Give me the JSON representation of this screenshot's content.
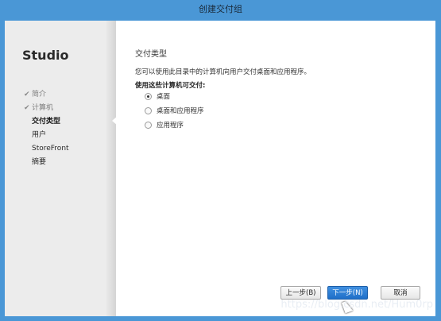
{
  "window": {
    "title": "创建交付组"
  },
  "sidebar": {
    "brand": "Studio",
    "steps": [
      {
        "label": "简介",
        "state": "done",
        "icon": "check-icon"
      },
      {
        "label": "计算机",
        "state": "done",
        "icon": "check-icon"
      },
      {
        "label": "交付类型",
        "state": "current"
      },
      {
        "label": "用户",
        "state": "future"
      },
      {
        "label": "StoreFront",
        "state": "future"
      },
      {
        "label": "摘要",
        "state": "future"
      }
    ]
  },
  "main": {
    "heading": "交付类型",
    "description": "您可以使用此目录中的计算机向用户交付桌面和应用程序。",
    "question": "使用这些计算机可交付:",
    "options": [
      {
        "label": "桌面",
        "checked": true
      },
      {
        "label": "桌面和应用程序",
        "checked": false
      },
      {
        "label": "应用程序",
        "checked": false
      }
    ]
  },
  "buttons": {
    "back": "上一步(B)",
    "next": "下一步(N)",
    "cancel": "取消"
  },
  "watermark": "https://blog.csdn.net/Hum0rp",
  "colors": {
    "titlebar": "#4a97d6",
    "primary_button": "#1f6fc8"
  }
}
